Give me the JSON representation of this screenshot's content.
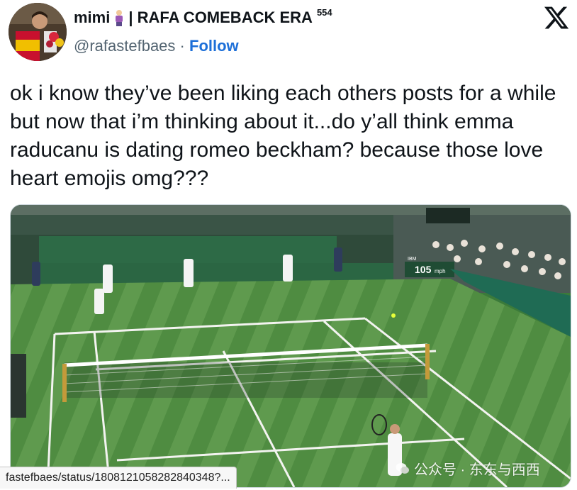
{
  "post": {
    "display_name": "mimi",
    "name_suffix": "| RAFA COMEBACK ERA",
    "superscript": "554",
    "handle": "@rafastefbaes",
    "separator": "·",
    "follow_label": "Follow",
    "text": "ok i know they’ve been liking each others posts for a while but now that i’m thinking about it...do y’all think emma raducanu is dating romeo beckham? because those love heart emojis omg???"
  },
  "media": {
    "scoreboard_value": "105",
    "scoreboard_unit": "mph",
    "scoreboard_brand": "IBM"
  },
  "status_bar": {
    "url": "fastefbaes/status/1808121058282840348?..."
  },
  "watermark": {
    "text": "公众号 · 东东与西西"
  },
  "colors": {
    "link": "#1d6fd8",
    "text": "#0f1419",
    "muted": "#536471",
    "grass_light": "#5f9a4e",
    "grass_dark": "#4b8a3e"
  },
  "icons": {
    "x_logo": "x-logo-icon",
    "avatar": "avatar",
    "wechat": "wechat-icon"
  }
}
